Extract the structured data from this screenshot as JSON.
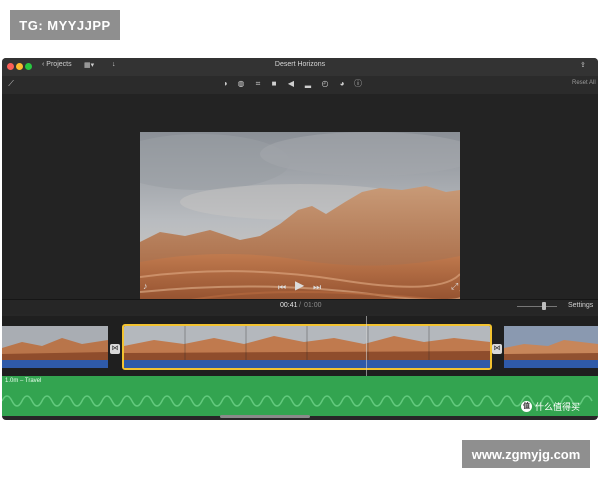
{
  "watermark": {
    "tag": "TG: MYYJJPP",
    "url": "www.zgmyjg.com",
    "site": "什么值得买",
    "site_glyph": "值"
  },
  "window": {
    "title": "Desert Horizons",
    "projects_label": "Projects",
    "reset_all": "Reset All",
    "settings": "Settings"
  },
  "colors": {
    "window_bg": "#272727",
    "clip_selected_border": "#f2c230",
    "audio_track": "#2f5aa8",
    "music_track": "#33a450"
  },
  "toolbar_icons": [
    "color-balance-icon",
    "color-correction-icon",
    "crop-icon",
    "stabilization-icon",
    "volume-icon",
    "noise-reduction-icon",
    "speed-icon",
    "clip-filter-icon",
    "info-icon"
  ],
  "playback": {
    "current": "00:41",
    "separator": "/",
    "total": "01:00"
  },
  "timeline": {
    "music_label": "1.0m – Travel",
    "clips": [
      {
        "name": "desert-clip-1",
        "selected": false
      },
      {
        "name": "desert-clip-2",
        "selected": true
      },
      {
        "name": "desert-clip-3",
        "selected": false
      }
    ]
  }
}
